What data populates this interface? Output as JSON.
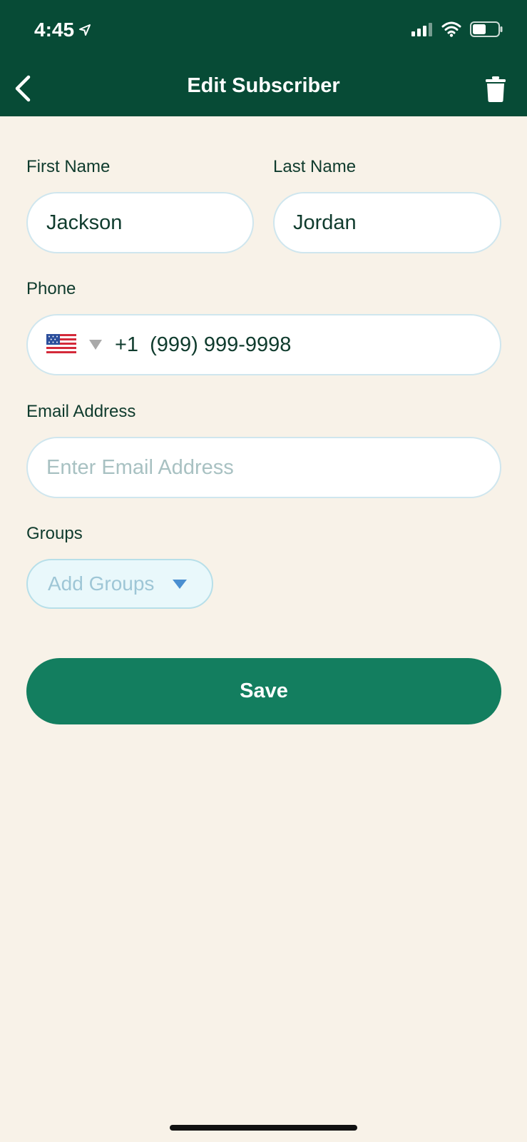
{
  "status_bar": {
    "time": "4:45"
  },
  "nav": {
    "title": "Edit Subscriber"
  },
  "form": {
    "first_name": {
      "label": "First Name",
      "value": "Jackson"
    },
    "last_name": {
      "label": "Last Name",
      "value": "Jordan"
    },
    "phone": {
      "label": "Phone",
      "country_code": "+1",
      "value": "(999) 999-9998",
      "flag_icon": "us-flag-icon"
    },
    "email": {
      "label": "Email Address",
      "placeholder": "Enter Email Address"
    },
    "groups": {
      "label": "Groups",
      "placeholder": "Add Groups"
    },
    "save_label": "Save"
  },
  "colors": {
    "header": "#074b36",
    "background": "#f8f2e8",
    "save_button": "#137e5f",
    "label_text": "#0f3b2d"
  }
}
